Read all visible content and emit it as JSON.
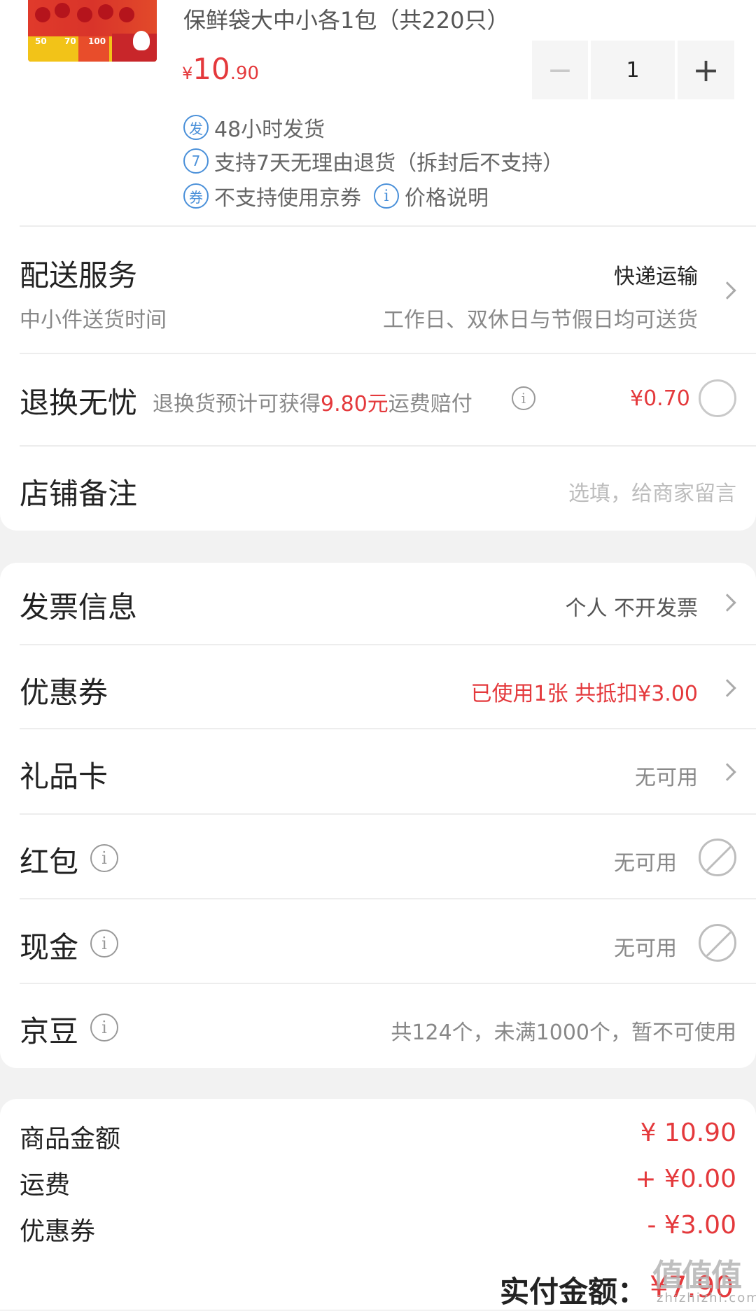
{
  "product": {
    "name": "保鲜袋大中小各1包（共220只）",
    "price_symbol": "¥",
    "price_int": "10",
    "price_dec": ".90",
    "quantity": "1",
    "thumb_labels": [
      "50",
      "70",
      "100"
    ]
  },
  "services": [
    {
      "icon": "发",
      "text": "48小时发货"
    },
    {
      "icon": "7",
      "text": "支持7天无理由退货（拆封后不支持）"
    },
    {
      "icon": "券",
      "text": "不支持使用京券"
    }
  ],
  "price_note": {
    "icon": "i",
    "text": "价格说明"
  },
  "delivery": {
    "title": "配送服务",
    "method": "快递运输",
    "sub_label": "中小件送货时间",
    "sub_value": "工作日、双休日与节假日均可送货"
  },
  "return_care": {
    "title": "退换无忧",
    "desc_prefix": "退换货预计可获得",
    "desc_amount": "9.80元",
    "desc_suffix": "运费赔付",
    "price": "¥0.70"
  },
  "shop_note": {
    "title": "店铺备注",
    "placeholder": "选填，给商家留言"
  },
  "invoice": {
    "title": "发票信息",
    "value": "个人 不开发票"
  },
  "coupon": {
    "title": "优惠券",
    "value": "已使用1张 共抵扣¥3.00"
  },
  "gift_card": {
    "title": "礼品卡",
    "value": "无可用"
  },
  "red_packet": {
    "title": "红包",
    "value": "无可用"
  },
  "cash": {
    "title": "现金",
    "value": "无可用"
  },
  "jingdou": {
    "title": "京豆",
    "value": "共124个，未满1000个，暂不可使用"
  },
  "summary": [
    {
      "label": "商品金额",
      "value": "¥ 10.90"
    },
    {
      "label": "运费",
      "value": "+ ¥0.00"
    },
    {
      "label": "优惠券",
      "value": "- ¥3.00"
    }
  ],
  "total": {
    "label": "实付金额：",
    "value": "¥7.90"
  },
  "watermark": {
    "main": "值值值",
    "sub": "zhizhizhi.com"
  },
  "colors": {
    "accent": "#e4393c",
    "service_icon": "#4a90d9"
  }
}
